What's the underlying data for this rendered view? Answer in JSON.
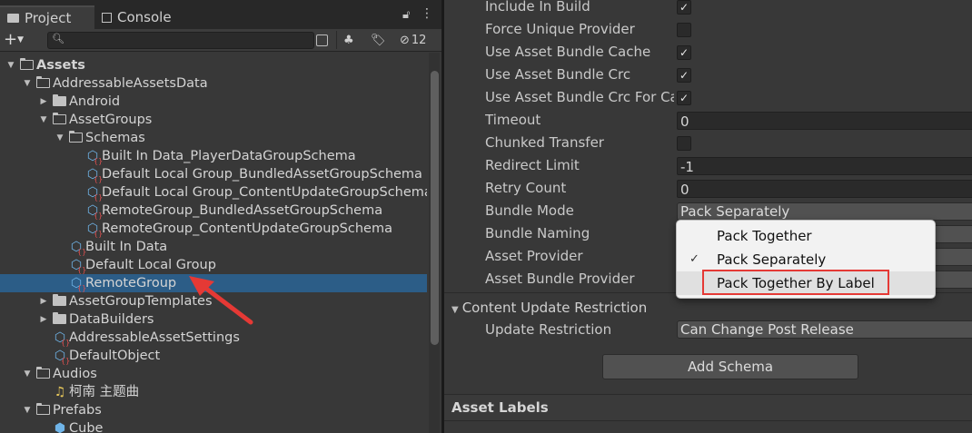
{
  "tabs": [
    {
      "label": "Project",
      "icon": "folder-icon",
      "active": true
    },
    {
      "label": "Console",
      "icon": "console-icon",
      "active": false
    }
  ],
  "toolbar": {
    "search_value": "",
    "hidden_count": "12"
  },
  "tree": [
    {
      "label": "Assets",
      "depth": 0,
      "type": "folder-open",
      "expanded": true,
      "bold": true
    },
    {
      "label": "AddressableAssetsData",
      "depth": 1,
      "type": "folder-open",
      "expanded": true
    },
    {
      "label": "Android",
      "depth": 2,
      "type": "folder",
      "expanded": false
    },
    {
      "label": "AssetGroups",
      "depth": 2,
      "type": "folder-open",
      "expanded": true
    },
    {
      "label": "Schemas",
      "depth": 3,
      "type": "folder-open",
      "expanded": true
    },
    {
      "label": "Built In Data_PlayerDataGroupSchema",
      "depth": 4,
      "type": "asset"
    },
    {
      "label": "Default Local Group_BundledAssetGroupSchema",
      "depth": 4,
      "type": "asset"
    },
    {
      "label": "Default Local Group_ContentUpdateGroupSchema",
      "depth": 4,
      "type": "asset"
    },
    {
      "label": "RemoteGroup_BundledAssetGroupSchema",
      "depth": 4,
      "type": "asset"
    },
    {
      "label": "RemoteGroup_ContentUpdateGroupSchema",
      "depth": 4,
      "type": "asset"
    },
    {
      "label": "Built In Data",
      "depth": 3,
      "type": "asset"
    },
    {
      "label": "Default Local Group",
      "depth": 3,
      "type": "asset"
    },
    {
      "label": "RemoteGroup",
      "depth": 3,
      "type": "asset",
      "selected": true
    },
    {
      "label": "AssetGroupTemplates",
      "depth": 2,
      "type": "folder",
      "expanded": false
    },
    {
      "label": "DataBuilders",
      "depth": 2,
      "type": "folder",
      "expanded": false
    },
    {
      "label": "AddressableAssetSettings",
      "depth": 2,
      "type": "asset"
    },
    {
      "label": "DefaultObject",
      "depth": 2,
      "type": "asset"
    },
    {
      "label": "Audios",
      "depth": 1,
      "type": "folder-open",
      "expanded": true
    },
    {
      "label": "柯南 主题曲",
      "depth": 2,
      "type": "audio"
    },
    {
      "label": "Prefabs",
      "depth": 1,
      "type": "folder-open",
      "expanded": true
    },
    {
      "label": "Cube",
      "depth": 2,
      "type": "prefab"
    }
  ],
  "inspector": {
    "properties": [
      {
        "label": "Include In Build",
        "kind": "checkbox",
        "checked": true
      },
      {
        "label": "Force Unique Provider",
        "kind": "checkbox",
        "checked": false
      },
      {
        "label": "Use Asset Bundle Cache",
        "kind": "checkbox",
        "checked": true
      },
      {
        "label": "Use Asset Bundle Crc",
        "kind": "checkbox",
        "checked": true
      },
      {
        "label": "Use Asset Bundle Crc For Cached Bundles",
        "kind": "checkbox",
        "checked": true
      },
      {
        "label": "Timeout",
        "kind": "field",
        "value": "0"
      },
      {
        "label": "Chunked Transfer",
        "kind": "checkbox",
        "checked": false
      },
      {
        "label": "Redirect Limit",
        "kind": "field",
        "value": "-1"
      },
      {
        "label": "Retry Count",
        "kind": "field",
        "value": "0"
      },
      {
        "label": "Bundle Mode",
        "kind": "dropdown",
        "value": "Pack Separately"
      },
      {
        "label": "Bundle Naming",
        "kind": "dropdown",
        "value": ""
      },
      {
        "label": "Asset Provider",
        "kind": "dropdown",
        "value": ""
      },
      {
        "label": "Asset Bundle Provider",
        "kind": "dropdown",
        "value": ""
      }
    ],
    "content_update": {
      "header": "Content Update Restriction",
      "update_restriction_label": "Update Restriction",
      "update_restriction_value": "Can Change Post Release"
    },
    "add_schema_label": "Add Schema",
    "asset_labels_title": "Asset Labels"
  },
  "bundle_mode_menu": {
    "options": [
      "Pack Together",
      "Pack Separately",
      "Pack Together By Label"
    ],
    "checked_index": 1,
    "highlighted_index": 2
  },
  "colors": {
    "selection": "#2c5d87",
    "annotation_red": "#e53935",
    "asset_icon": "#6fb4e8"
  }
}
